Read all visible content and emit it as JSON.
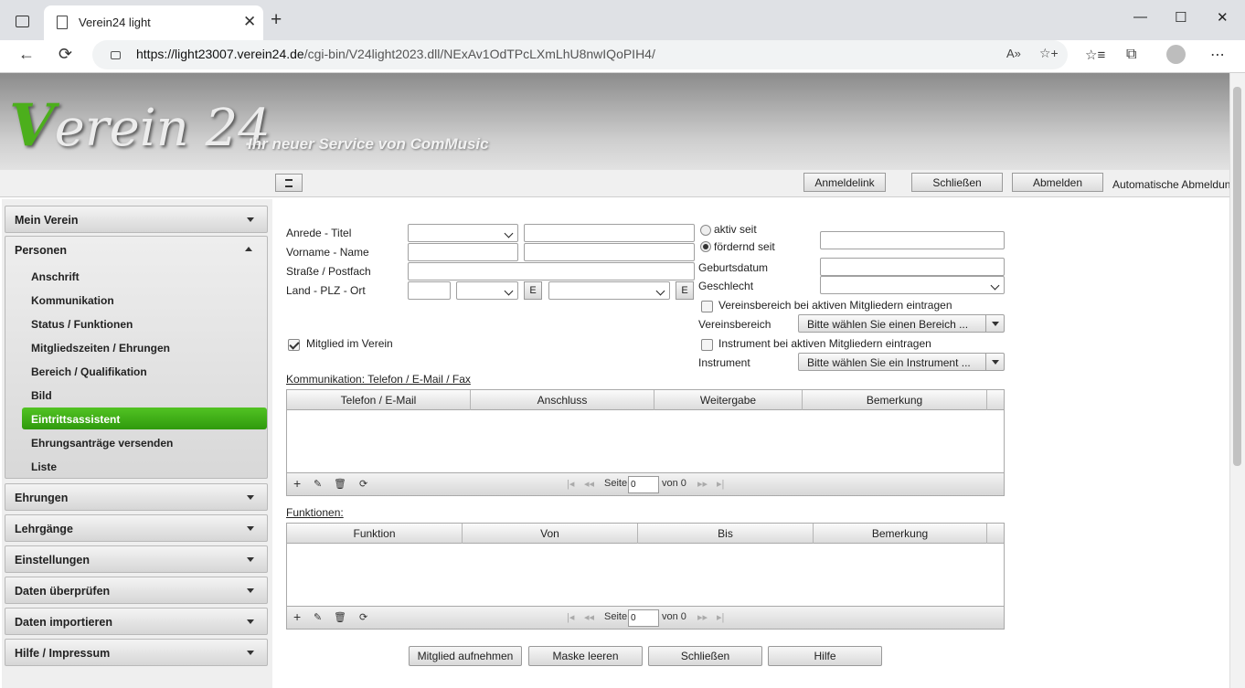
{
  "browser": {
    "tab_title": "Verein24 light",
    "url_host": "https://light23007.verein24.de",
    "url_path": "/cgi-bin/V24light2023.dll/NExAv1OdTPcLXmLhU8nwIQoPIH4/",
    "icons": {
      "back": "←",
      "reload": "⟳",
      "newtab": "+",
      "close": "✕",
      "min": "—",
      "max": "☐",
      "more": "⋯",
      "read": "A»",
      "fav": "☆+",
      "favs": "☆≡",
      "collections": "⧉"
    }
  },
  "header": {
    "logo_v": "V",
    "logo_rest": "erein 24",
    "tagline": "Ihr neuer Service von ComMusic"
  },
  "toolbar": {
    "anmeldelink": "Anmeldelink",
    "schliessen": "Schließen",
    "abmelden": "Abmelden",
    "auto_logout": "Automatische Abmeldung"
  },
  "sidebar": {
    "mein_verein": "Mein Verein",
    "personen": "Personen",
    "personen_items": [
      "Anschrift",
      "Kommunikation",
      "Status / Funktionen",
      "Mitgliedszeiten / Ehrungen",
      "Bereich / Qualifikation",
      "Bild",
      "Eintrittsassistent",
      "Ehrungsanträge versenden",
      "Liste"
    ],
    "ehrungen": "Ehrungen",
    "lehrgaenge": "Lehrgänge",
    "einstellungen": "Einstellungen",
    "daten_pruefen": "Daten überprüfen",
    "daten_import": "Daten importieren",
    "hilfe": "Hilfe / Impressum"
  },
  "form": {
    "anrede": "Anrede - Titel",
    "vorname": "Vorname - Name",
    "strasse": "Straße / Postfach",
    "land": "Land - PLZ - Ort",
    "e": "E",
    "aktiv_seit": "aktiv seit",
    "foerdernd_seit": "fördernd seit",
    "geburtsdatum": "Geburtsdatum",
    "geschlecht": "Geschlecht",
    "vb_eintragen": "Vereinsbereich bei aktiven Mitgliedern eintragen",
    "vereinsbereich": "Vereinsbereich",
    "vb_placeholder": "Bitte wählen Sie einen Bereich ...",
    "mitglied": "Mitglied im Verein",
    "instr_eintragen": "Instrument bei aktiven Mitgliedern eintragen",
    "instrument": "Instrument",
    "instr_placeholder": "Bitte wählen Sie ein Instrument ..."
  },
  "komm": {
    "title": "Kommunikation: Telefon / E-Mail / Fax",
    "cols": [
      "Telefon / E-Mail",
      "Anschluss",
      "Weitergabe",
      "Bemerkung"
    ]
  },
  "funk": {
    "title": "Funktionen:",
    "cols": [
      "Funktion",
      "Von",
      "Bis",
      "Bemerkung"
    ]
  },
  "pager": {
    "seite": "Seite",
    "page": "0",
    "von": "von 0"
  },
  "buttons": {
    "aufnehmen": "Mitglied aufnehmen",
    "leeren": "Maske leeren",
    "schliessen": "Schließen",
    "hilfe": "Hilfe"
  }
}
